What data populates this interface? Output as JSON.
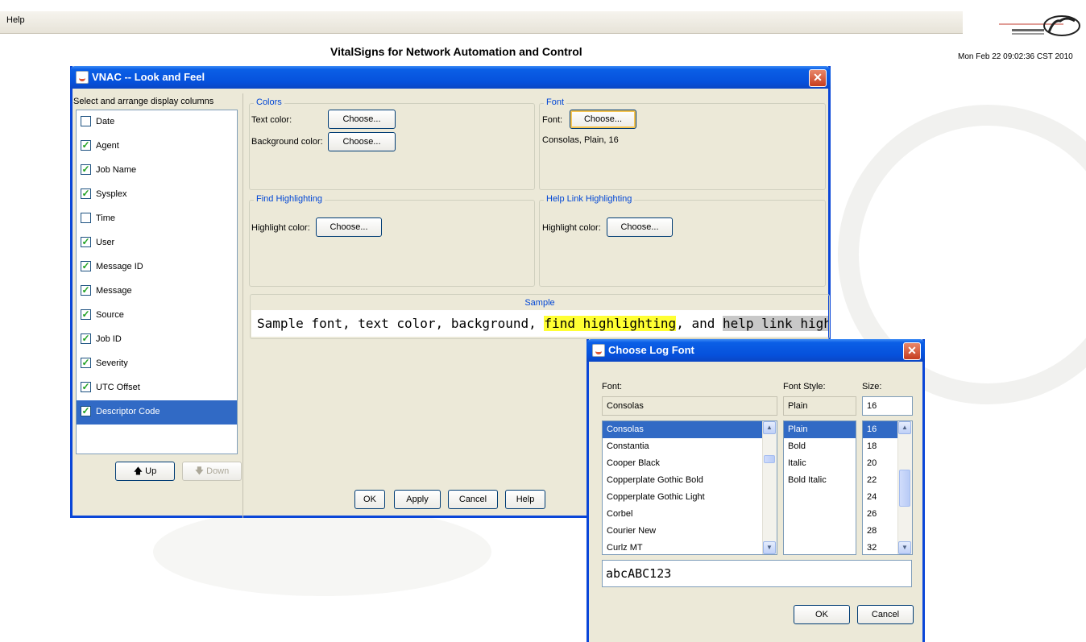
{
  "menubar": {
    "help": "Help"
  },
  "app": {
    "title": "VitalSigns for Network Automation and Control",
    "datetime": "Mon Feb 22 09:02:36 CST 2010"
  },
  "look_and_feel": {
    "title": "VNAC -- Look and Feel",
    "columns_label": "Select and arrange display columns",
    "columns": [
      {
        "label": "Date",
        "checked": false
      },
      {
        "label": "Agent",
        "checked": true
      },
      {
        "label": "Job Name",
        "checked": true
      },
      {
        "label": "Sysplex",
        "checked": true
      },
      {
        "label": "Time",
        "checked": false
      },
      {
        "label": "User",
        "checked": true
      },
      {
        "label": "Message ID",
        "checked": true
      },
      {
        "label": "Message",
        "checked": true
      },
      {
        "label": "Source",
        "checked": true
      },
      {
        "label": "Job ID",
        "checked": true
      },
      {
        "label": "Severity",
        "checked": true
      },
      {
        "label": "UTC Offset",
        "checked": true
      },
      {
        "label": "Descriptor Code",
        "checked": true,
        "selected": true
      }
    ],
    "up_label": "Up",
    "down_label": "Down",
    "colors": {
      "title": "Colors",
      "text_color_label": "Text color:",
      "background_color_label": "Background color:",
      "choose": "Choose..."
    },
    "font": {
      "title": "Font",
      "label": "Font:",
      "choose": "Choose...",
      "current": "Consolas, Plain, 16"
    },
    "find_highlighting": {
      "title": "Find Highlighting",
      "label": "Highlight color:",
      "choose": "Choose..."
    },
    "help_link_highlighting": {
      "title": "Help Link Highlighting",
      "label": "Highlight color:",
      "choose": "Choose..."
    },
    "sample": {
      "title": "Sample",
      "part1": "Sample font, text color, background, ",
      "find": "find highlighting",
      "part2": ", and ",
      "help": "help link highl"
    },
    "buttons": {
      "ok": "OK",
      "apply": "Apply",
      "cancel": "Cancel",
      "help": "Help"
    }
  },
  "font_dialog": {
    "title": "Choose Log Font",
    "font_label": "Font:",
    "style_label": "Font Style:",
    "size_label": "Size:",
    "font_value": "Consolas",
    "style_value": "Plain",
    "size_value": "16",
    "fonts": [
      "Consolas",
      "Constantia",
      "Cooper Black",
      "Copperplate Gothic Bold",
      "Copperplate Gothic Light",
      "Corbel",
      "Courier New",
      "Curlz MT"
    ],
    "styles": [
      "Plain",
      "Bold",
      "Italic",
      "Bold Italic"
    ],
    "sizes": [
      "16",
      "18",
      "20",
      "22",
      "24",
      "26",
      "28",
      "32"
    ],
    "preview": "abcABC123",
    "ok": "OK",
    "cancel": "Cancel"
  },
  "colors": {
    "title_blue": "#0651dc",
    "group_title": "#0046d5",
    "selection": "#316ac5",
    "find_highlight": "#ffff33",
    "help_highlight": "#c8c8c8"
  }
}
